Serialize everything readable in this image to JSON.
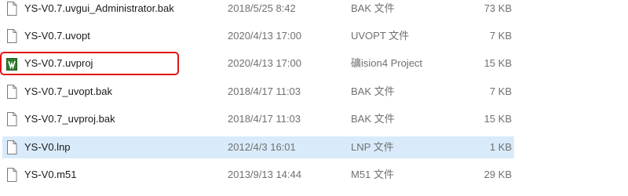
{
  "files": [
    {
      "name": "YS-V0.7.uvgui_Administrator.bak",
      "date": "2018/5/25 8:42",
      "type": "BAK 文件",
      "size": "73 KB",
      "icon": "file-icon"
    },
    {
      "name": "YS-V0.7.uvopt",
      "date": "2020/4/13 17:00",
      "type": "UVOPT 文件",
      "size": "7 KB",
      "icon": "file-icon"
    },
    {
      "name": "YS-V0.7.uvproj",
      "date": "2020/4/13 17:00",
      "type": "礦ision4 Project",
      "size": "15 KB",
      "icon": "keil-project-icon"
    },
    {
      "name": "YS-V0.7_uvopt.bak",
      "date": "2018/4/17 11:03",
      "type": "BAK 文件",
      "size": "7 KB",
      "icon": "file-icon"
    },
    {
      "name": "YS-V0.7_uvproj.bak",
      "date": "2018/4/17 11:03",
      "type": "BAK 文件",
      "size": "15 KB",
      "icon": "file-icon"
    },
    {
      "name": "YS-V0.lnp",
      "date": "2012/4/3 16:01",
      "type": "LNP 文件",
      "size": "1 KB",
      "icon": "file-icon"
    },
    {
      "name": "YS-V0.m51",
      "date": "2013/9/13 14:44",
      "type": "M51 文件",
      "size": "29 KB",
      "icon": "file-icon"
    }
  ],
  "selected_index": 5,
  "highlighted_index": 2,
  "colors": {
    "selection": "#d9ebfb",
    "highlight_border": "#e01414",
    "keil_icon": "#2f7d2f"
  }
}
